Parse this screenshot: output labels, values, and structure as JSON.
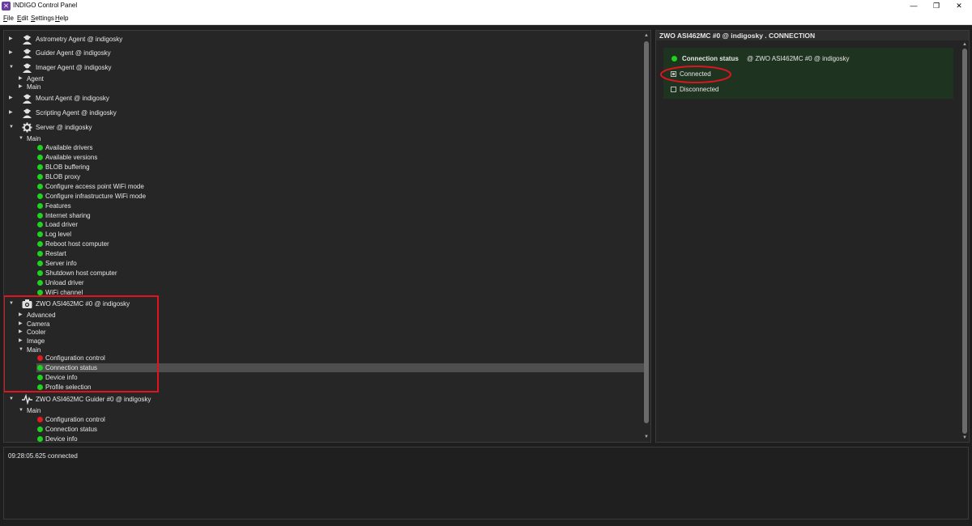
{
  "window": {
    "title": "INDIGO Control Panel",
    "minimize_glyph": "—",
    "maximize_glyph": "❐",
    "close_glyph": "✕"
  },
  "menu": [
    {
      "first": "F",
      "rest": "ile"
    },
    {
      "first": "E",
      "rest": "dit"
    },
    {
      "first": "S",
      "rest": "ettings"
    },
    {
      "first": "H",
      "rest": "elp"
    }
  ],
  "tree": {
    "astrometry_agent": "Astrometry Agent @ indigosky",
    "guider_agent": "Guider Agent @ indigosky",
    "imager_agent": "Imager Agent @ indigosky",
    "imager_children": [
      "Agent",
      "Main"
    ],
    "mount_agent": "Mount Agent @ indigosky",
    "scripting_agent": "Scripting Agent @ indigosky",
    "server": "Server @ indigosky",
    "server_main": "Main",
    "server_props": [
      "Available drivers",
      "Available versions",
      "BLOB buffering",
      "BLOB proxy",
      "Configure access point WiFi mode",
      "Configure infrastructure WiFi mode",
      "Features",
      "Internet sharing",
      "Load driver",
      "Log level",
      "Reboot host computer",
      "Restart",
      "Server info",
      "Shutdown host computer",
      "Unload driver",
      "WiFi channel"
    ],
    "camera_device": "ZWO ASI462MC #0 @ indigosky",
    "camera_groups": [
      "Advanced",
      "Camera",
      "Cooler",
      "Image",
      "Main"
    ],
    "camera_props": [
      {
        "label": "Configuration control",
        "state": "red"
      },
      {
        "label": "Connection status",
        "state": "green"
      },
      {
        "label": "Device info",
        "state": "green"
      },
      {
        "label": "Profile selection",
        "state": "green"
      }
    ],
    "guider_device": "ZWO ASI462MC Guider #0 @ indigosky",
    "guider_main": "Main",
    "guider_props": [
      {
        "label": "Configuration control",
        "state": "red"
      },
      {
        "label": "Connection status",
        "state": "green"
      },
      {
        "label": "Device info",
        "state": "green"
      }
    ]
  },
  "detail": {
    "header": "ZWO ASI462MC #0 @ indigosky . CONNECTION",
    "property_label": "Connection status",
    "property_device": "@ ZWO ASI462MC #0 @ indigosky",
    "option_connected": "Connected",
    "option_disconnected": "Disconnected",
    "connected_checked": true
  },
  "log": {
    "line": "09:28:05.625 connected"
  },
  "colors": {
    "ok": "#1ed21e",
    "alert": "#e01e1e",
    "highlight_box": "#e0141e",
    "group_bg": "#1f3420"
  }
}
